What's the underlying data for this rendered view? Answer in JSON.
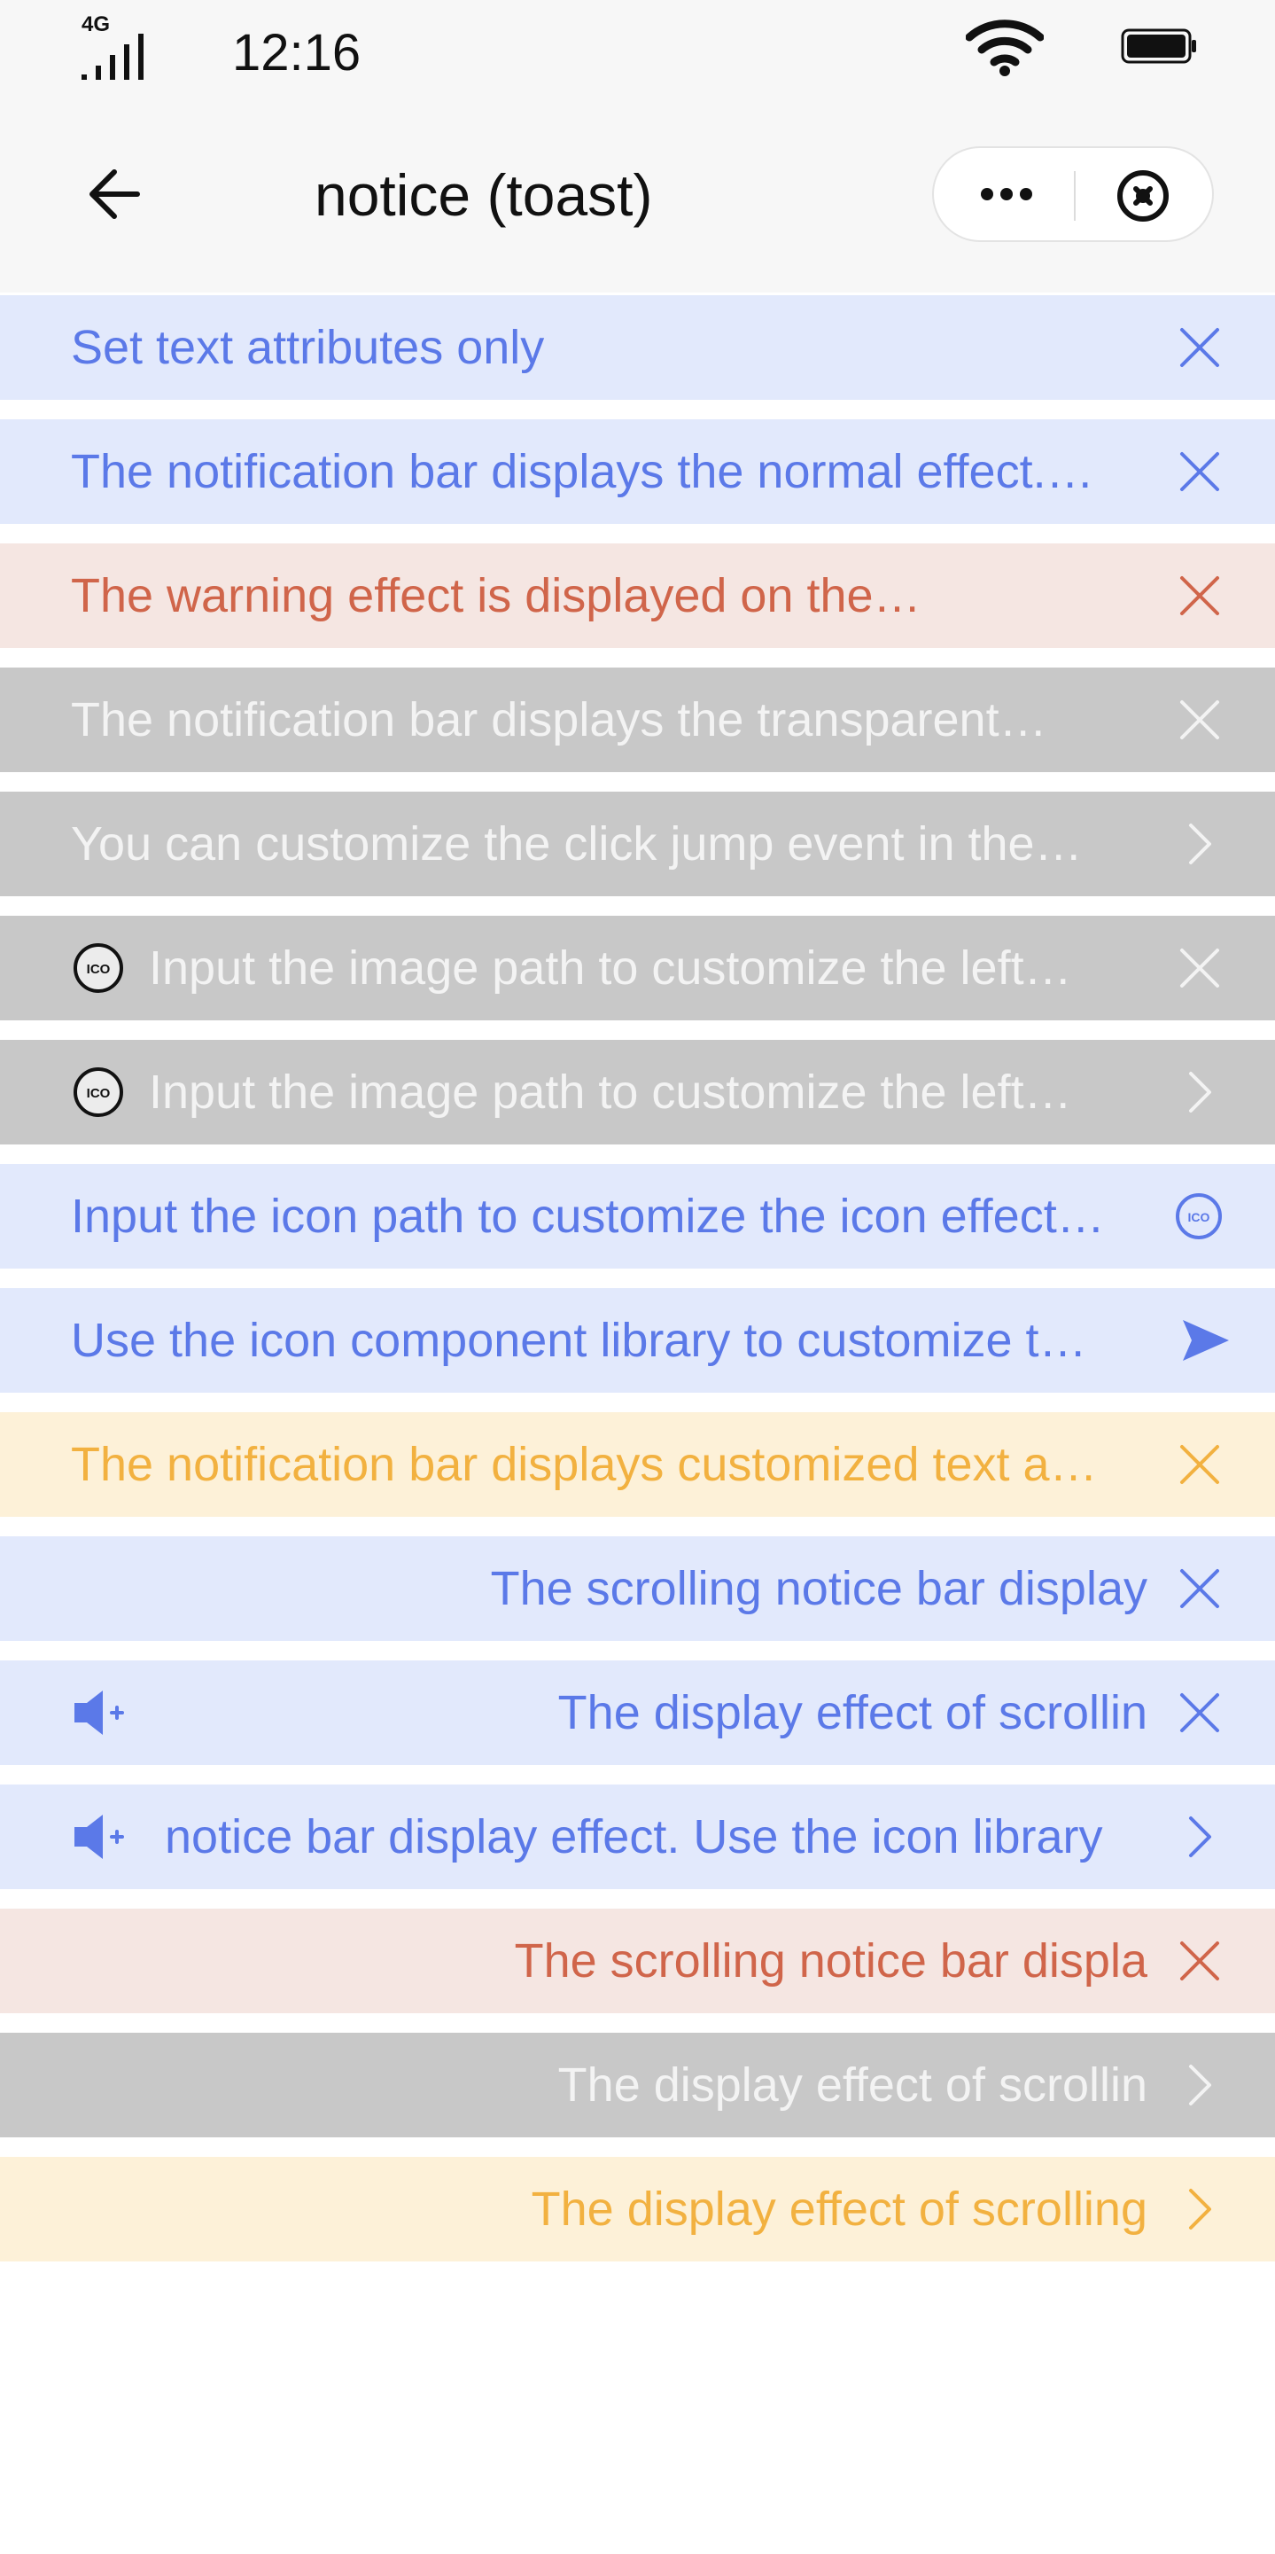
{
  "status_bar": {
    "network": "4G",
    "time": "12:16"
  },
  "nav": {
    "title": "notice (toast)"
  },
  "colors": {
    "blue_text": "#5b79e8",
    "blue_bg": "#e2e9fc",
    "red_text": "#d0654a",
    "red_bg": "#f5e6e2",
    "gray_text": "#f3f3f3",
    "gray_bg": "#c8c8c8",
    "yellow_text": "#f2b140",
    "yellow_bg": "#fdf1d8"
  },
  "notices": [
    {
      "text": "Set text attributes only",
      "right_icon": "close-icon"
    },
    {
      "text": "The notification bar displays the normal effect.…",
      "right_icon": "close-icon"
    },
    {
      "text": "The warning effect is displayed on the…",
      "right_icon": "close-icon"
    },
    {
      "text": "The notification bar displays the transparent…",
      "right_icon": "close-icon"
    },
    {
      "text": "You can customize the click jump event in the…",
      "right_icon": "chevron-right-icon"
    },
    {
      "text": "Input the image path to customize the left…",
      "left_icon": "ico-image-icon",
      "right_icon": "close-icon"
    },
    {
      "text": "Input the image path to customize the left…",
      "left_icon": "ico-image-icon",
      "right_icon": "chevron-right-icon"
    },
    {
      "text": "Input the icon path to customize the icon effect…",
      "right_icon": "ico-custom-icon"
    },
    {
      "text": "Use the icon component library to customize t…",
      "right_icon": "play-arrow-icon"
    },
    {
      "text": "The notification bar displays customized text a…",
      "right_icon": "close-icon"
    },
    {
      "text": "The scrolling notice bar display",
      "right_icon": "close-icon"
    },
    {
      "text": "The display effect of scrollin",
      "left_icon": "speaker-icon",
      "right_icon": "close-icon"
    },
    {
      "text": "notice bar display effect. Use the icon library",
      "left_icon": "speaker-icon",
      "right_icon": "chevron-right-icon"
    },
    {
      "text": "The scrolling notice bar displa",
      "right_icon": "close-icon"
    },
    {
      "text": "The display effect of scrollin",
      "right_icon": "chevron-right-icon"
    },
    {
      "text": "The display effect of scrolling",
      "right_icon": "chevron-right-icon"
    }
  ]
}
